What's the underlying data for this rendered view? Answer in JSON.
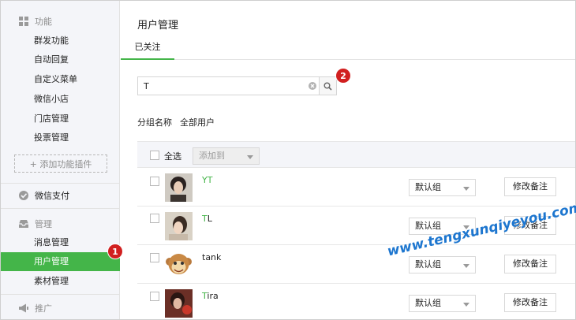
{
  "sidebar": {
    "sections": {
      "function": {
        "label": "功能",
        "icon": "grid-icon"
      },
      "wechat_pay": {
        "label": "微信支付",
        "icon": "wechat-pay-icon"
      },
      "manage": {
        "label": "管理",
        "icon": "tray-icon"
      },
      "promote": {
        "label": "推广",
        "icon": "megaphone-icon"
      }
    },
    "function_items": [
      "群发功能",
      "自动回复",
      "自定义菜单",
      "微信小店",
      "门店管理",
      "投票管理"
    ],
    "add_plugin": "+ 添加功能插件",
    "manage_items": [
      "消息管理",
      "用户管理",
      "素材管理"
    ],
    "active_item": "用户管理",
    "accent": "#44b549"
  },
  "badges": [
    "1",
    "2"
  ],
  "main": {
    "title": "用户管理",
    "tab": "已关注",
    "search": {
      "value": "T"
    },
    "group_label": "分组名称",
    "group_value": "全部用户",
    "table": {
      "select_all": "全选",
      "add_to": "添加到",
      "rows": [
        {
          "name_hl": "Y",
          "name_hl2": "T",
          "name_rest": "",
          "group": "默认组",
          "remark": "修改备注"
        },
        {
          "name_hl": "T",
          "name_rest": "L",
          "group": "默认组",
          "remark": "修改备注"
        },
        {
          "name_hl": "",
          "name_rest": "tank",
          "group": "默认组",
          "remark": "修改备注"
        },
        {
          "name_hl": "T",
          "name_rest": "ira",
          "group": "默认组",
          "remark": "修改备注"
        }
      ]
    }
  },
  "watermark": "www.tengxunqiyeyou.com"
}
